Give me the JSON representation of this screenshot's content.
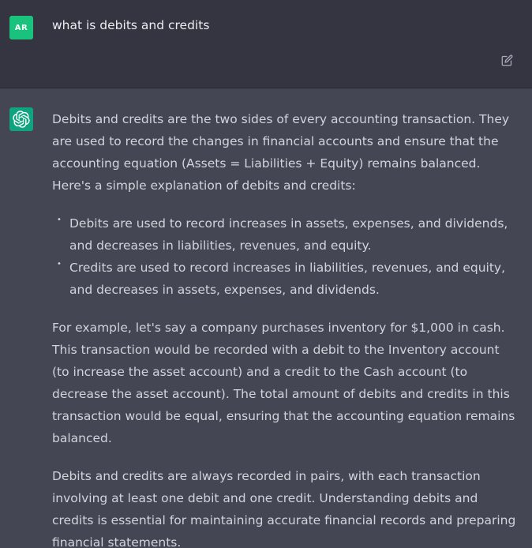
{
  "user": {
    "avatar_initials": "AR",
    "avatar_color": "#19c37d",
    "message": "what is debits and credits",
    "edit_icon": "edit-icon"
  },
  "assistant": {
    "avatar_icon": "openai-logo-icon",
    "avatar_color": "#10a37f",
    "paragraph_1": "Debits and credits are the two sides of every accounting transaction. They are used to record the changes in financial accounts and ensure that the accounting equation (Assets = Liabilities + Equity) remains balanced. Here's a simple explanation of debits and credits:",
    "bullets": [
      "Debits are used to record increases in assets, expenses, and dividends, and decreases in liabilities, revenues, and equity.",
      "Credits are used to record increases in liabilities, revenues, and equity, and decreases in assets, expenses, and dividends."
    ],
    "paragraph_2": "For example, let's say a company purchases inventory for $1,000 in cash. This transaction would be recorded with a debit to the Inventory account (to increase the asset account) and a credit to the Cash account (to decrease the asset account). The total amount of debits and credits in this transaction would be equal, ensuring that the accounting equation remains balanced.",
    "paragraph_3": "Debits and credits are always recorded in pairs, with each transaction involving at least one debit and one credit. Understanding debits and credits is essential for maintaining accurate financial records and preparing financial statements."
  },
  "colors": {
    "user_background": "#343541",
    "assistant_background": "#444654",
    "text": "#d1d5db"
  }
}
